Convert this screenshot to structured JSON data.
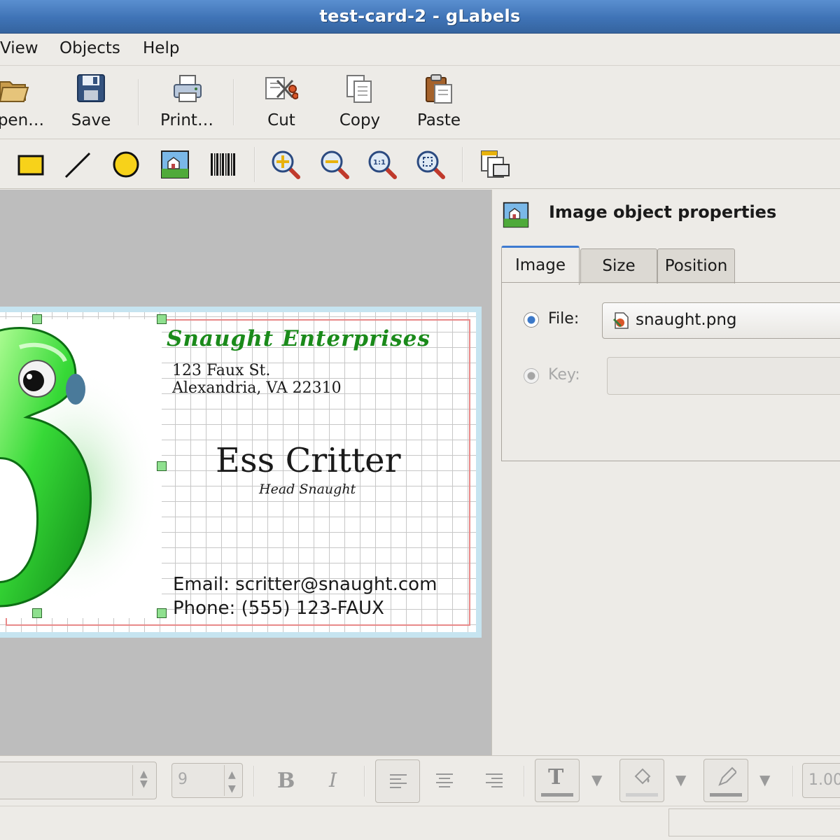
{
  "window": {
    "title": "test-card-2 - gLabels"
  },
  "menu": [
    "View",
    "Objects",
    "Help"
  ],
  "toolbar": {
    "open": "pen…",
    "save": "Save",
    "print": "Print…",
    "cut": "Cut",
    "copy": "Copy",
    "paste": "Paste"
  },
  "draw_tools": [
    "rectangle-tool",
    "line-tool",
    "ellipse-tool",
    "image-tool",
    "barcode-tool",
    "zoom-in",
    "zoom-out",
    "zoom-1to1",
    "zoom-fit",
    "merge-properties"
  ],
  "card": {
    "company": "Snaught Enterprises",
    "address1": "123 Faux St.",
    "address2": "Alexandria, VA 22310",
    "name": "Ess Critter",
    "job_title": "Head Snaught",
    "email": "Email: scritter@snaught.com",
    "phone": "Phone: (555) 123-FAUX",
    "company_color": "#1a8a1a"
  },
  "panel": {
    "title": "Image object properties",
    "tabs": [
      "Image",
      "Size",
      "Position"
    ],
    "active_tab": "Image",
    "file_label": "File:",
    "file_value": "snaught.png",
    "key_label": "Key:",
    "key_value": ""
  },
  "bottom": {
    "font_size": "9",
    "bold": "B",
    "italic": "I",
    "text_color_glyph": "T",
    "line_width": "1.00"
  }
}
